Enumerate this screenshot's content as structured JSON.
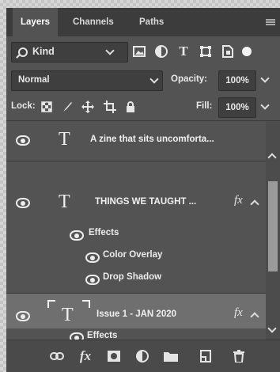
{
  "tabs": [
    {
      "label": "Layers"
    },
    {
      "label": "Channels"
    },
    {
      "label": "Paths"
    }
  ],
  "filter": {
    "kind_label": "Kind",
    "icons": [
      "image-filter-icon",
      "adjustment-filter-icon",
      "type-filter-icon",
      "shape-filter-icon",
      "smart-object-filter-icon",
      "filter-toggle-icon"
    ]
  },
  "blend": {
    "mode": "Normal",
    "opacity_label": "Opacity:",
    "opacity_value": "100%"
  },
  "lock": {
    "label": "Lock:",
    "fill_label": "Fill:",
    "fill_value": "100%"
  },
  "layers": [
    {
      "type_glyph": "T",
      "name": "A zine that sits uncomforta..."
    },
    {
      "type_glyph": "T",
      "name": "THINGS  WE TAUGHT  ...",
      "fx": "fx",
      "effects_label": "Effects",
      "effects": [
        "Color Overlay",
        "Drop Shadow"
      ]
    },
    {
      "type_glyph": "T",
      "name": "Issue 1 - JAN 2020",
      "fx": "fx",
      "selected": true,
      "effects_label": "Effects"
    }
  ],
  "bottom_icons": [
    "link-layers-icon",
    "fx-icon",
    "add-mask-icon",
    "adjustment-layer-icon",
    "new-group-icon",
    "new-layer-icon",
    "delete-icon"
  ],
  "bottom_fx_label": "fx"
}
